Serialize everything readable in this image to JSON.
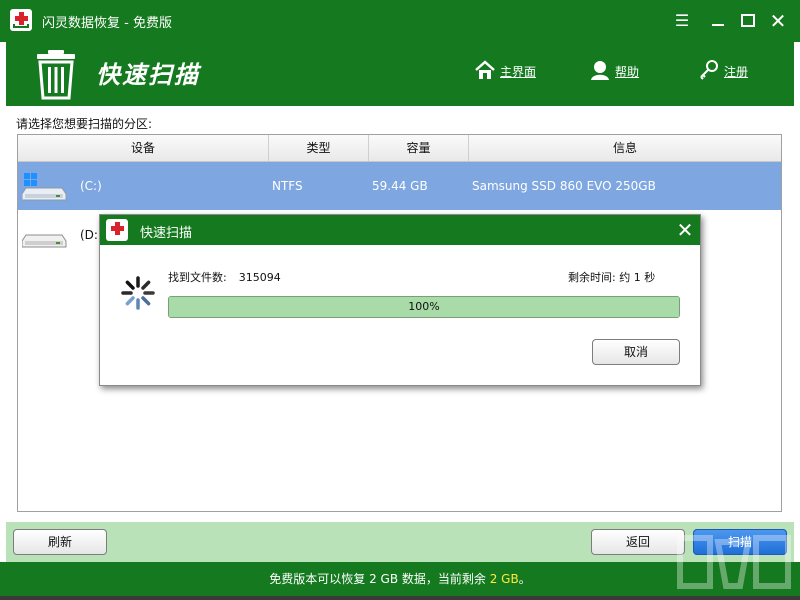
{
  "window": {
    "title": "闪灵数据恢复 - 免费版"
  },
  "header": {
    "title": "快速扫描",
    "nav": [
      {
        "label": "主界面",
        "icon": "home-icon"
      },
      {
        "label": "帮助",
        "icon": "user-help-icon"
      },
      {
        "label": "注册",
        "icon": "key-icon"
      }
    ]
  },
  "content": {
    "prompt": "请选择您想要扫描的分区:",
    "columns": [
      "设备",
      "类型",
      "容量",
      "信息"
    ],
    "partitions": [
      {
        "device": "(C:)",
        "type": "NTFS",
        "capacity": "59.44 GB",
        "info": "Samsung SSD 860 EVO 250GB",
        "icon": "windows-drive-icon",
        "selected": true
      },
      {
        "device": "(D:)",
        "type": "",
        "capacity": "",
        "info": "",
        "icon": "hard-drive-icon",
        "selected": false
      }
    ]
  },
  "footer": {
    "refresh": "刷新",
    "back": "返回",
    "scan": "扫描",
    "status_prefix": "免费版本可以恢复 2 GB 数据，当前剩余",
    "status_highlight": "2 GB",
    "status_suffix": "。"
  },
  "dialog": {
    "title": "快速扫描",
    "found_label": "找到文件数:",
    "found_value": "315094",
    "remaining": "剩余时间: 约 1 秒",
    "progress_percent": 100,
    "progress_text": "100%",
    "cancel": "取消"
  },
  "colors": {
    "brand_green": "#157a1f",
    "footer_green": "#b9e2b8",
    "selected_row": "#7ea6e0",
    "scan_button": "#1f6fd8",
    "status_highlight": "#ffea3b"
  }
}
